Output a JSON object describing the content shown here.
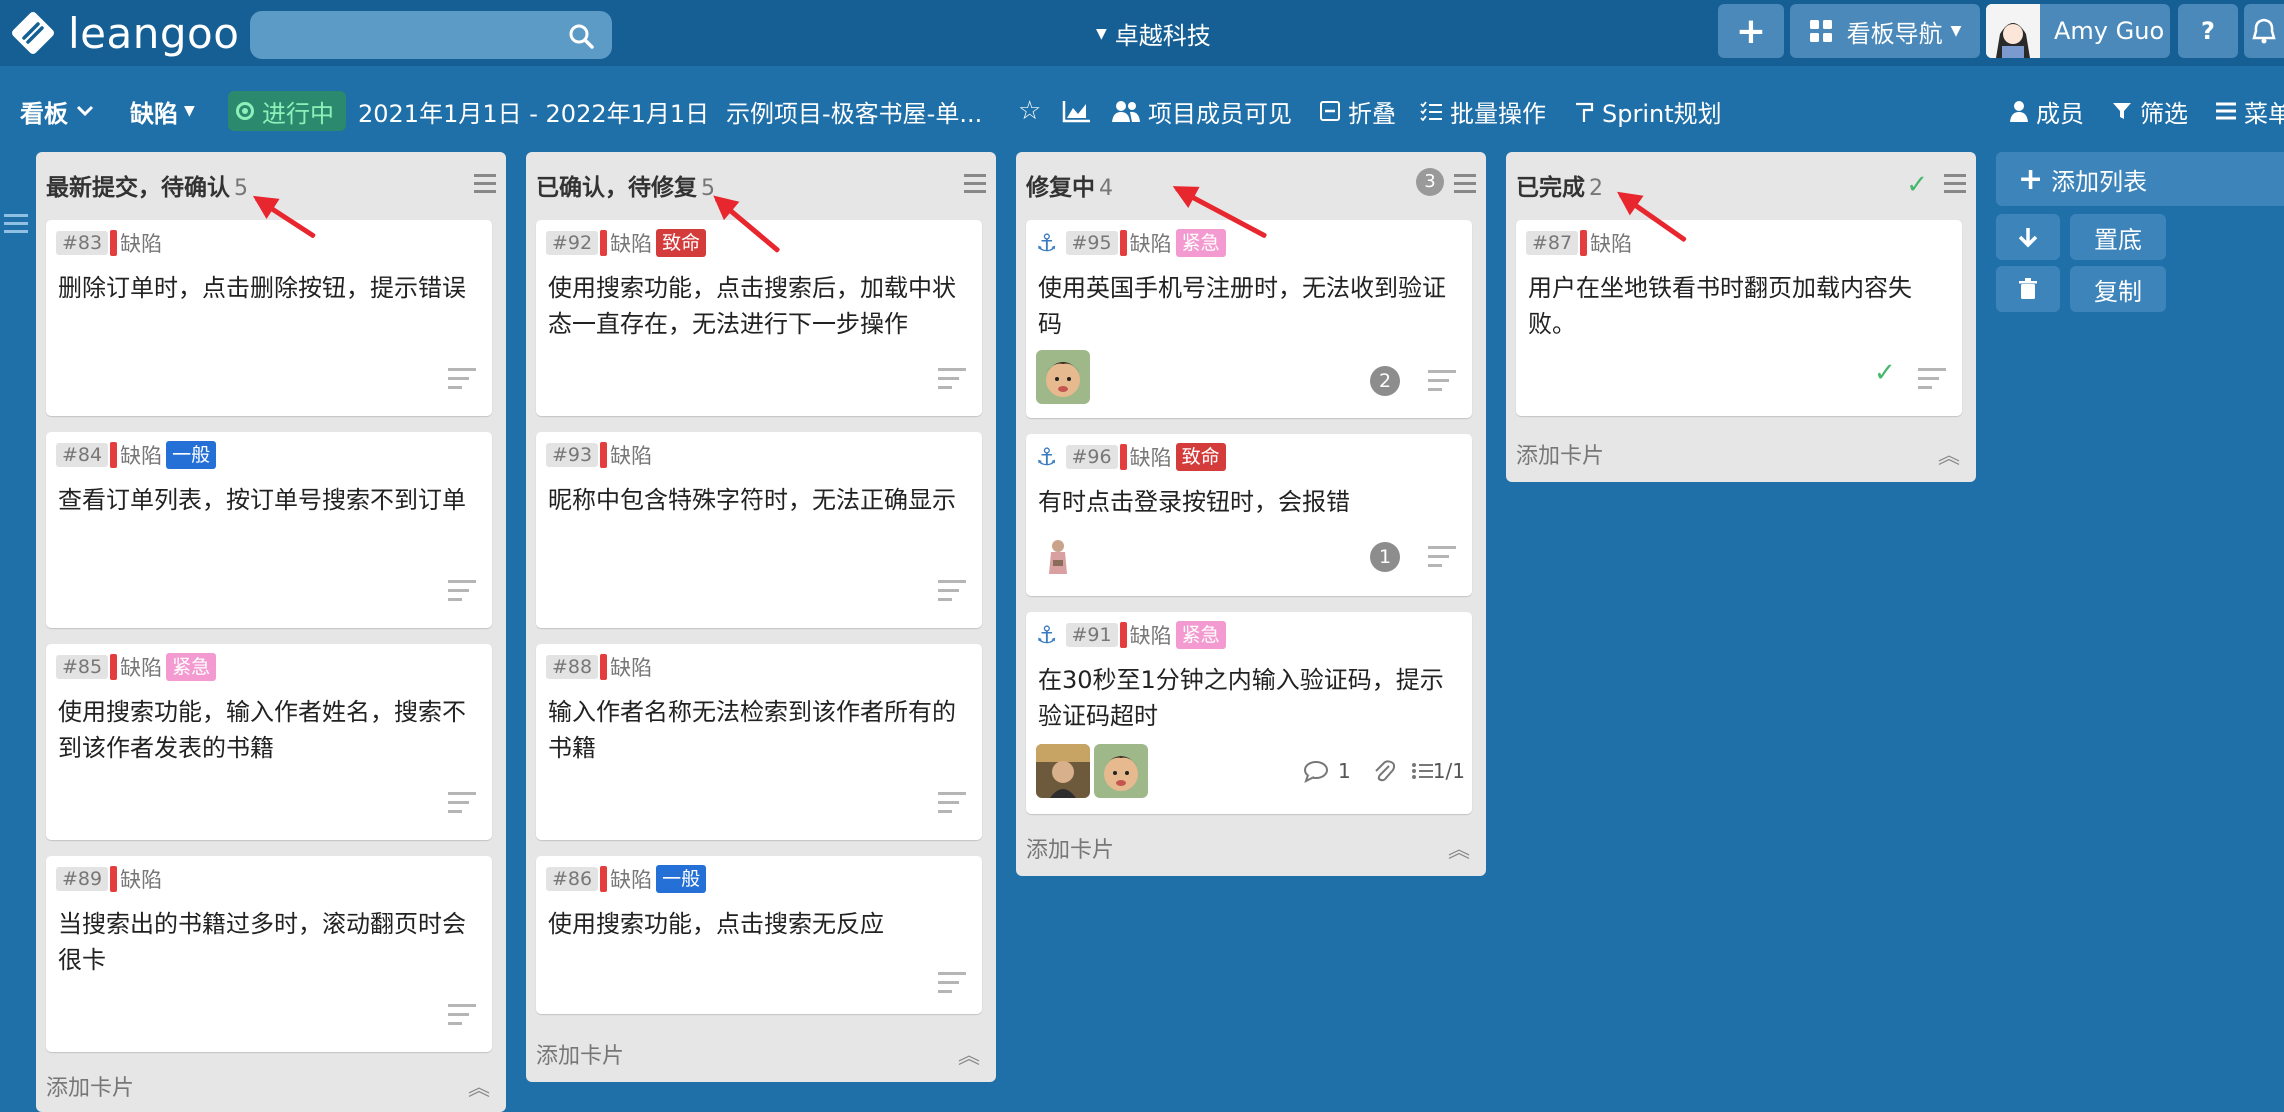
{
  "app": {
    "logo_text": "leangoo",
    "org_name": "卓越科技",
    "board_nav_label": "看板导航",
    "user_name": "Amy Guo",
    "help_label": "?"
  },
  "subbar": {
    "view_label": "看板",
    "board_label": "缺陷",
    "status_label": "进行中",
    "date_range": "2021年1月1日 - 2022年1月1日",
    "board_title": "示例项目-极客书屋-单...",
    "visibility_label": "项目成员可见",
    "collapse_label": "折叠",
    "batch_label": "批量操作",
    "sprint_label": "Sprint规划",
    "members_label": "成员",
    "filter_label": "筛选",
    "menu_label": "菜单"
  },
  "labels": {
    "add_card": "添加卡片",
    "add_list": "添加列表",
    "bottom": "置底",
    "copy": "复制"
  },
  "colors": {
    "background": "#1f6fa8",
    "topbar": "#155f94",
    "bug_red": "#e33d3d",
    "tag_fatal": "#d43c3c",
    "tag_normal": "#2570d6",
    "tag_urgent": "#f39bd0",
    "status_green": "#8ef0b8",
    "arrow_red": "#e8262e"
  },
  "lists": [
    {
      "title": "最新提交，待确认",
      "count": "5",
      "cards": [
        {
          "id": "#83",
          "type": "缺陷",
          "tag": "",
          "text": "删除订单时，点击删除按钮，提示错误"
        },
        {
          "id": "#84",
          "type": "缺陷",
          "tag": "一般",
          "text": "查看订单列表，按订单号搜索不到订单"
        },
        {
          "id": "#85",
          "type": "缺陷",
          "tag": "紧急",
          "text": "使用搜索功能，输入作者姓名，搜索不到该作者发表的书籍"
        },
        {
          "id": "#89",
          "type": "缺陷",
          "tag": "",
          "text": "当搜索出的书籍过多时，滚动翻页时会很卡"
        }
      ]
    },
    {
      "title": "已确认，待修复",
      "count": "5",
      "cards": [
        {
          "id": "#92",
          "type": "缺陷",
          "tag": "致命",
          "text": "使用搜索功能，点击搜索后，加载中状态一直存在，无法进行下一步操作"
        },
        {
          "id": "#93",
          "type": "缺陷",
          "tag": "",
          "text": "昵称中包含特殊字符时，无法正确显示"
        },
        {
          "id": "#88",
          "type": "缺陷",
          "tag": "",
          "text": "输入作者名称无法检索到该作者所有的书籍"
        },
        {
          "id": "#86",
          "type": "缺陷",
          "tag": "一般",
          "text": "使用搜索功能，点击搜索无反应"
        }
      ]
    },
    {
      "title": "修复中",
      "count": "4",
      "wip": "3",
      "cards": [
        {
          "id": "#95",
          "type": "缺陷",
          "tag": "紧急",
          "text": "使用英国手机号注册时，无法收到验证码",
          "comments": "2"
        },
        {
          "id": "#96",
          "type": "缺陷",
          "tag": "致命",
          "text": "有时点击登录按钮时，会报错",
          "comments": "1"
        },
        {
          "id": "#91",
          "type": "缺陷",
          "tag": "紧急",
          "text": "在30秒至1分钟之内输入验证码，提示验证码超时",
          "comment_count": "1",
          "checklist": "1/1"
        }
      ]
    },
    {
      "title": "已完成",
      "count": "2",
      "cards": [
        {
          "id": "#87",
          "type": "缺陷",
          "tag": "",
          "text": "用户在坐地铁看书时翻页加载内容失败。"
        }
      ]
    }
  ]
}
